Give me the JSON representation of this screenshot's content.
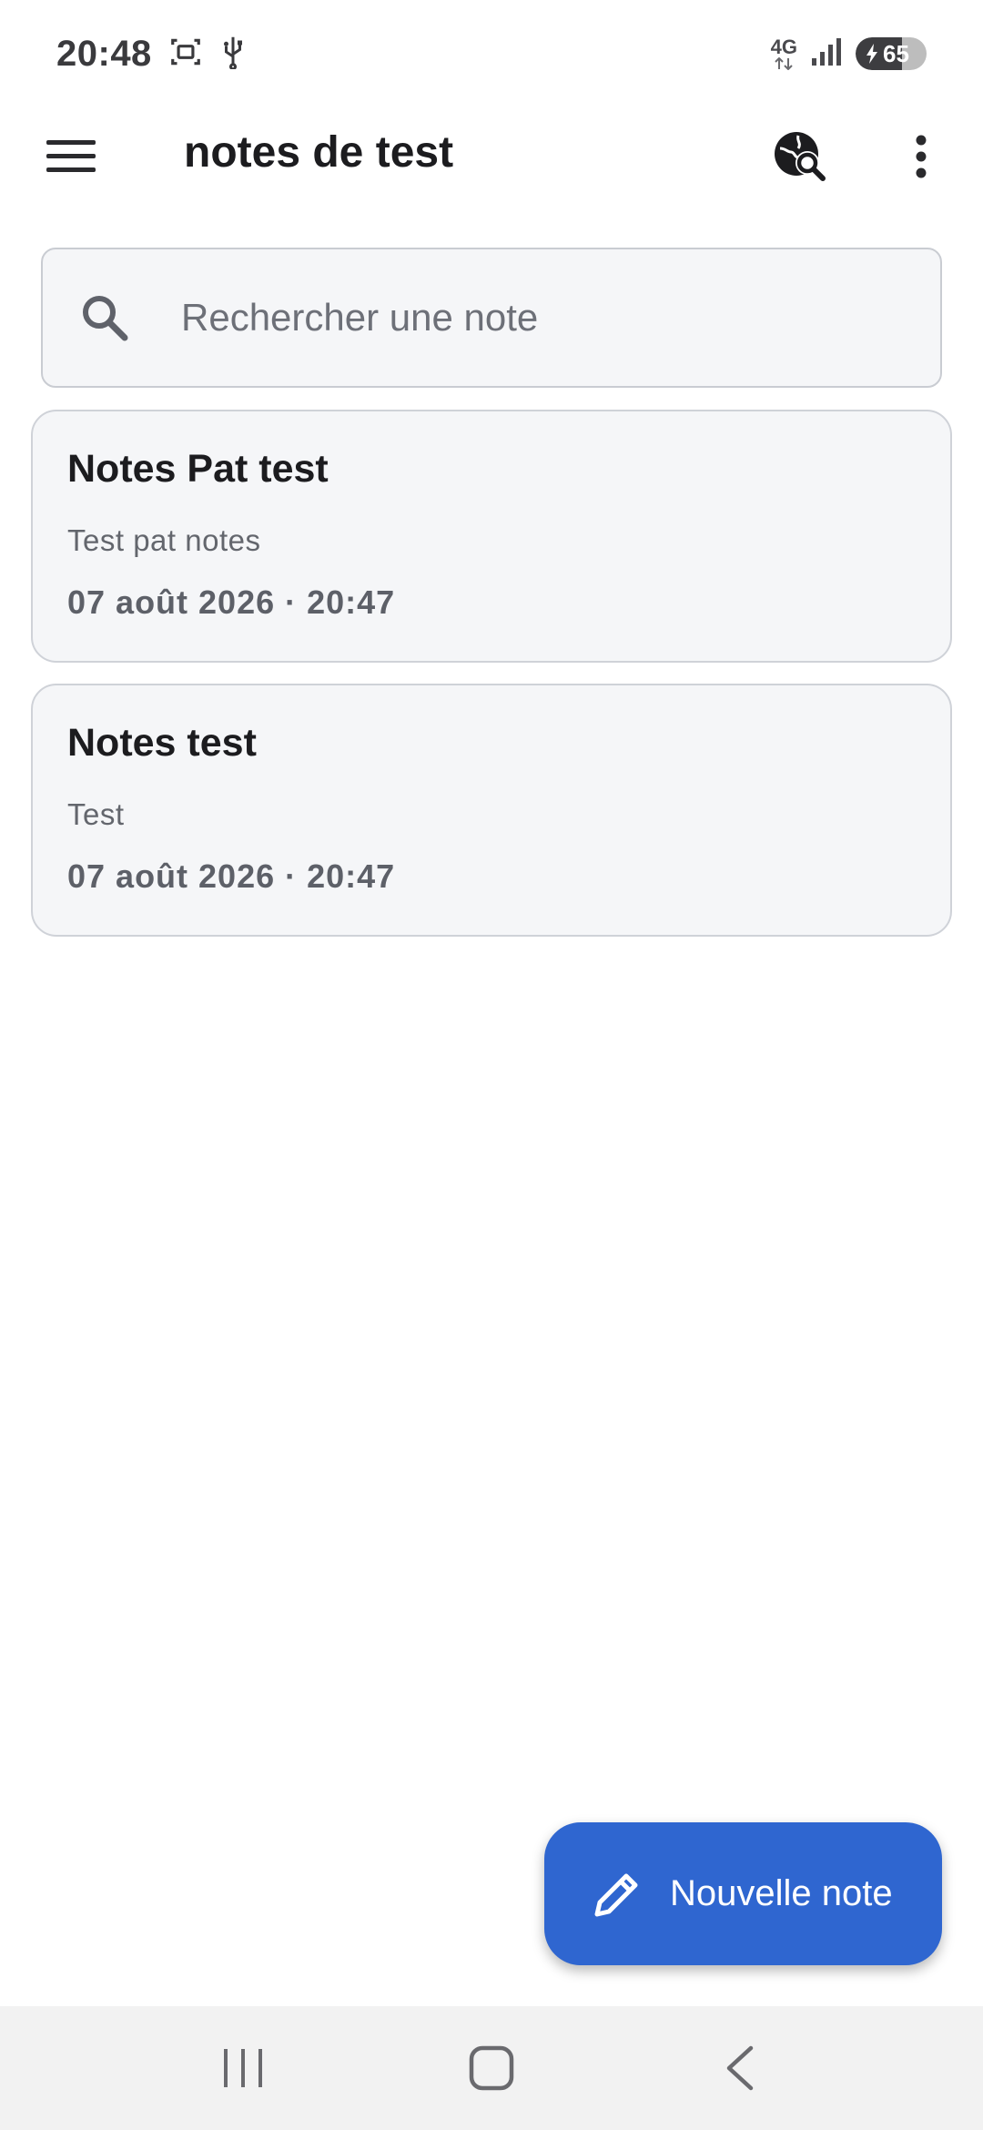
{
  "status_bar": {
    "time": "20:48",
    "network": "4G",
    "battery": "65",
    "battery_level": 0.65,
    "icons": [
      "screenshot-icon",
      "usb-icon",
      "signal-icon",
      "battery-charging-icon"
    ]
  },
  "app_bar": {
    "title": "notes de test",
    "icons": [
      "menu-icon",
      "globe-search-icon",
      "more-vert-icon"
    ]
  },
  "search": {
    "placeholder": "Rechercher une note",
    "value": ""
  },
  "notes": [
    {
      "title": "Notes Pat test",
      "body": "Test pat notes",
      "date": "07 août 2026 · 20:47"
    },
    {
      "title": "Notes test",
      "body": "Test",
      "date": "07 août 2026 · 20:47"
    }
  ],
  "fab": {
    "label": "Nouvelle note",
    "icon": "pencil-icon"
  },
  "nav_bar": {
    "icons": [
      "recents-icon",
      "home-icon",
      "back-icon"
    ]
  },
  "colors": {
    "accent": "#2f66d0",
    "card_background": "#f5f6f8",
    "card_border": "#cfd2d8"
  }
}
